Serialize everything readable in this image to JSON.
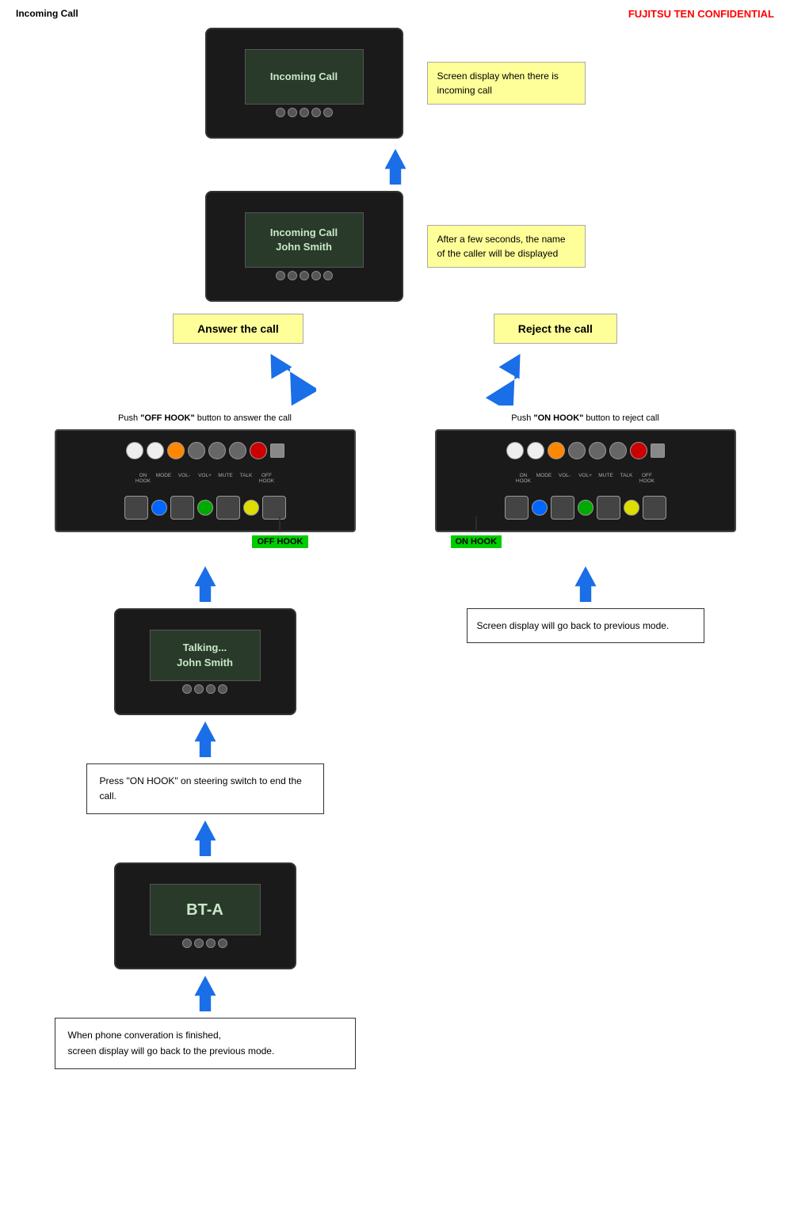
{
  "header": {
    "title": "Incoming Call",
    "confidential": "FUJITSU TEN CONFIDENTIAL"
  },
  "steps": {
    "device1_screen": "Incoming Call",
    "device2_screen_line1": "Incoming Call",
    "device2_screen_line2": "John Smith",
    "note1": "Screen display when there is incoming call",
    "note2": "After a few seconds, the name of the caller will be displayed",
    "answer_label": "Answer the call",
    "reject_label": "Reject the call",
    "push_answer": "Push",
    "off_hook": "\"OFF HOOK\"",
    "push_answer_suffix": "button to answer the call",
    "push_reject": "Push",
    "on_hook": "\"ON HOOK\"",
    "push_reject_suffix": "button to reject call",
    "off_hook_tag": "OFF HOOK",
    "on_hook_tag": "ON HOOK",
    "talking_line1": "Talking...",
    "talking_line2": "John Smith",
    "bt_screen": "BT-A",
    "end_call_box": "Press \"ON  HOOK\"  on steering switch to end the call.",
    "finish_box_line1": "When phone converation is finished,",
    "finish_box_line2": "screen display will  go back to the previous mode.",
    "back_to_previous": "Screen display will go back to previous mode."
  }
}
